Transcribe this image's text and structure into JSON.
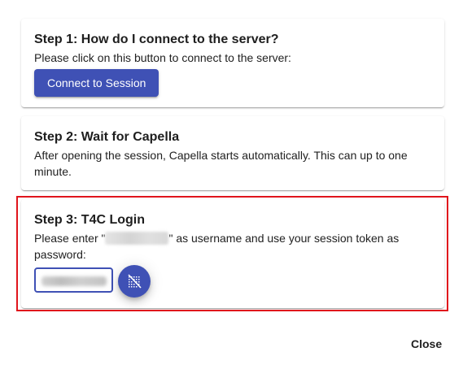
{
  "steps": [
    {
      "title": "Step 1: How do I connect to the server?",
      "text": "Please click on this button to connect to the server:",
      "button_label": "Connect to Session"
    },
    {
      "title": "Step 2: Wait for Capella",
      "text": "After opening the session, Capella starts automatically. This can up to one minute."
    },
    {
      "title": "Step 3: T4C Login",
      "text_before": "Please enter \"",
      "text_after": "\" as username and use your session token as password:",
      "password_toggle_icon": "visibility-off-icon"
    }
  ],
  "dialog": {
    "close_label": "Close"
  },
  "highlight_color": "#e0141c",
  "accent_color": "#3f51b5"
}
